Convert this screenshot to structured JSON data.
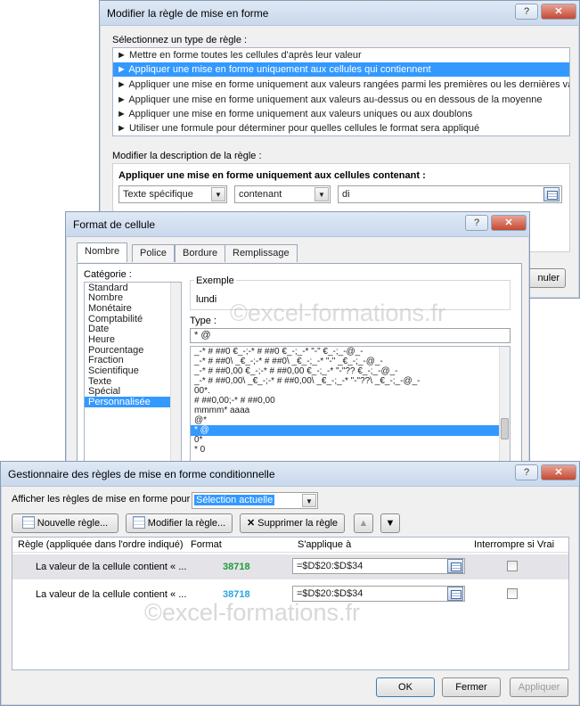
{
  "dlg1": {
    "title": "Modifier la règle de mise en forme",
    "help": "?",
    "close": "✕",
    "select_label": "Sélectionnez un type de règle :",
    "rule_types": [
      "► Mettre en forme toutes les cellules d'après leur valeur",
      "► Appliquer une mise en forme uniquement aux cellules qui contiennent",
      "► Appliquer une mise en forme uniquement aux valeurs rangées parmi les premières ou les dernières valeurs",
      "► Appliquer une mise en forme uniquement aux valeurs au-dessus ou en dessous de la moyenne",
      "► Appliquer une mise en forme uniquement aux valeurs uniques ou aux doublons",
      "► Utiliser une formule pour déterminer pour quelles cellules le format sera appliqué"
    ],
    "desc_label": "Modifier la description de la règle :",
    "apply_label": "Appliquer une mise en forme uniquement aux cellules contenant :",
    "combo1": "Texte spécifique",
    "combo2": "contenant",
    "value": "di",
    "cancel_partial": "nuler"
  },
  "dlg2": {
    "title": "Format de cellule",
    "help": "?",
    "close": "✕",
    "tabs": [
      "Nombre",
      "Police",
      "Bordure",
      "Remplissage"
    ],
    "category_label": "Catégorie :",
    "categories": [
      "Standard",
      "Nombre",
      "Monétaire",
      "Comptabilité",
      "Date",
      "Heure",
      "Pourcentage",
      "Fraction",
      "Scientifique",
      "Texte",
      "Spécial",
      "Personnalisée"
    ],
    "example_label": "Exemple",
    "example_value": "lundi",
    "type_label": "Type :",
    "type_value": "* @",
    "formats": [
      "_-* # ##0 €_-;-* # ##0 €_-;_-* \"-\" €_-;_-@_-",
      "_-* # ##0\\ _€_-;-* # ##0\\ _€_-;_-* \"-\" _€_-;_-@_-",
      "_-* # ##0,00 €_-;-* # ##0,00 €_-;_-* \"-\"?? €_-;_-@_-",
      "_-* # ##0,00\\ _€_-;-* # ##0,00\\ _€_-;_-* \"-\"??\\ _€_-;_-@_-",
      "00*.",
      "# ##0,00;-* # ##0,00",
      "mmmm* aaaa",
      "@*",
      "* @",
      "0*",
      "* 0"
    ]
  },
  "dlg3": {
    "title": "Gestionnaire des règles de mise en forme conditionnelle",
    "help": "?",
    "close": "✕",
    "show_label": "Afficher les règles de mise en forme pour :",
    "show_value": "Sélection actuelle",
    "new_rule": "Nouvelle règle...",
    "edit_rule": "Modifier la règle...",
    "delete_rule": "Supprimer la règle",
    "col_rule": "Règle (appliquée dans l'ordre indiqué)",
    "col_format": "Format",
    "col_applies": "S'applique à",
    "col_stop": "Interrompre si Vrai",
    "rows": [
      {
        "rule": "La valeur de la cellule contient « ...",
        "format": "38718",
        "applies": "=$D$20:$D$34",
        "color": "#1f9a3a"
      },
      {
        "rule": "La valeur de la cellule contient « ...",
        "format": "38718",
        "applies": "=$D$20:$D$34",
        "color": "#2aa6e0"
      }
    ],
    "ok": "OK",
    "close_btn": "Fermer",
    "apply": "Appliquer"
  },
  "watermark": "©excel-formations.fr"
}
